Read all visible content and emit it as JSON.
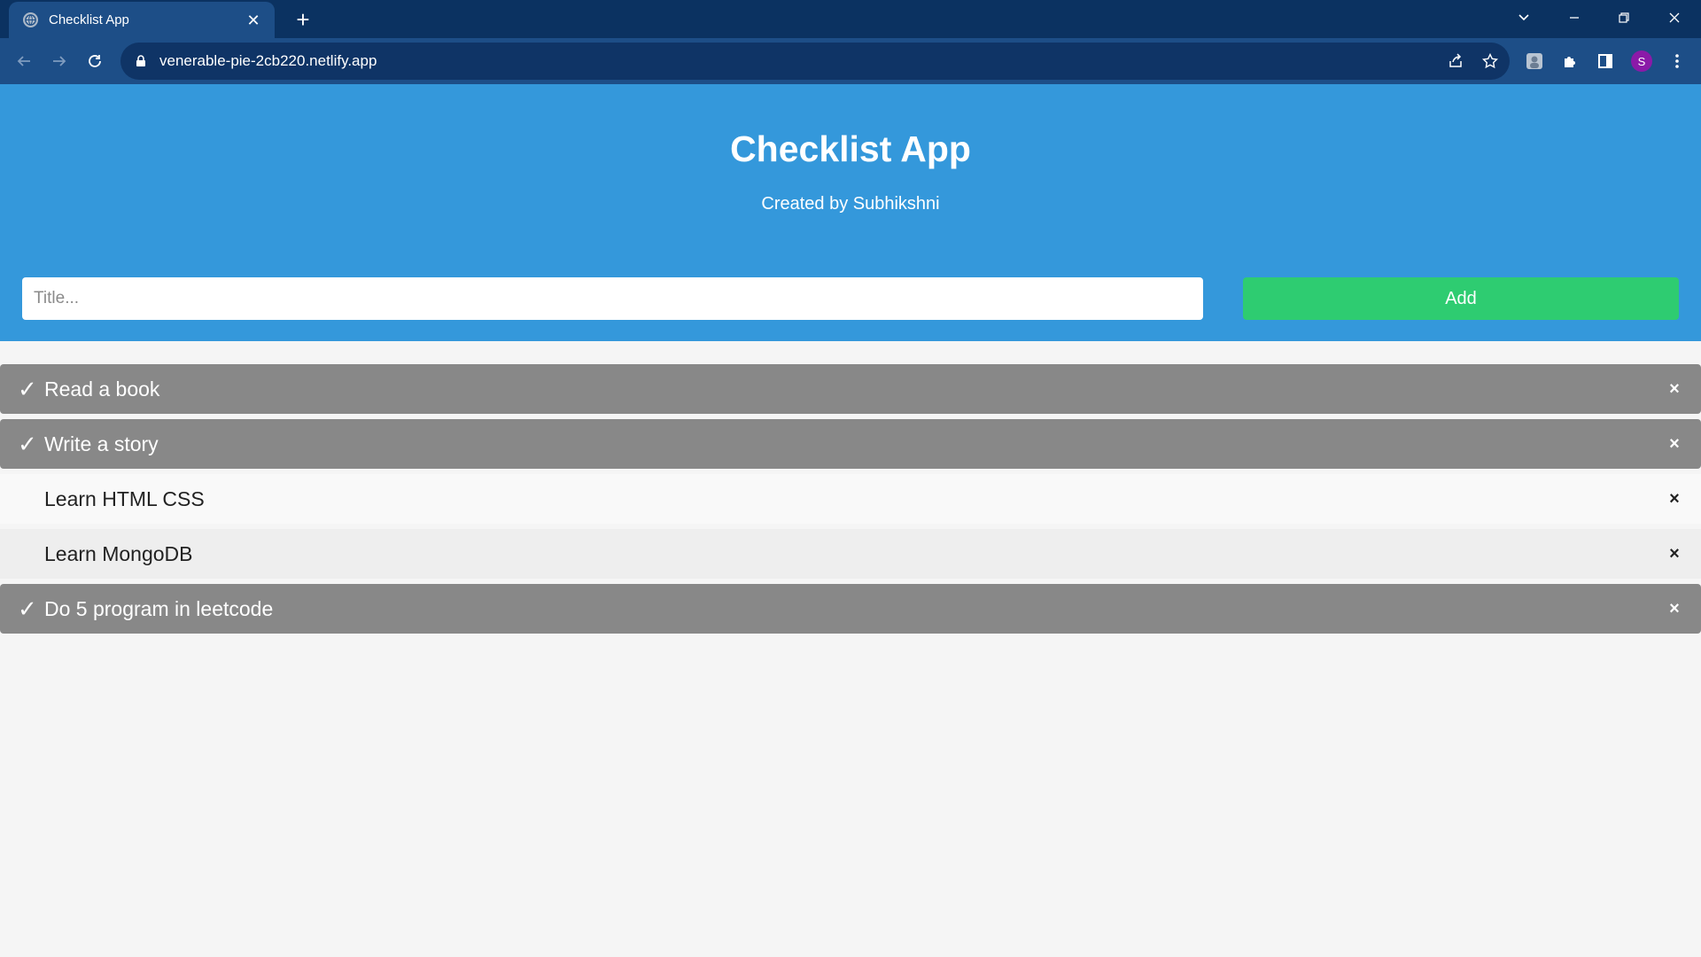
{
  "browser": {
    "tab_title": "Checklist App",
    "tab_close": "✕",
    "new_tab": "+",
    "url": "venerable-pie-2cb220.netlify.app",
    "profile_initial": "S"
  },
  "app": {
    "title": "Checklist App",
    "subtitle": "Created by Subhikshni",
    "input_placeholder": "Title...",
    "add_label": "Add",
    "check_symbol": "✓",
    "close_symbol": "×",
    "items": [
      {
        "text": "Read a book",
        "checked": true
      },
      {
        "text": "Write a story",
        "checked": true
      },
      {
        "text": "Learn HTML CSS",
        "checked": false
      },
      {
        "text": "Learn MongoDB",
        "checked": false
      },
      {
        "text": "Do 5 program in leetcode",
        "checked": true
      }
    ]
  },
  "colors": {
    "header_bg": "#3498db",
    "add_button": "#2ecc71",
    "checked_item": "#888888",
    "chrome_dark": "#0b3261",
    "chrome_toolbar": "#1d4e87"
  }
}
